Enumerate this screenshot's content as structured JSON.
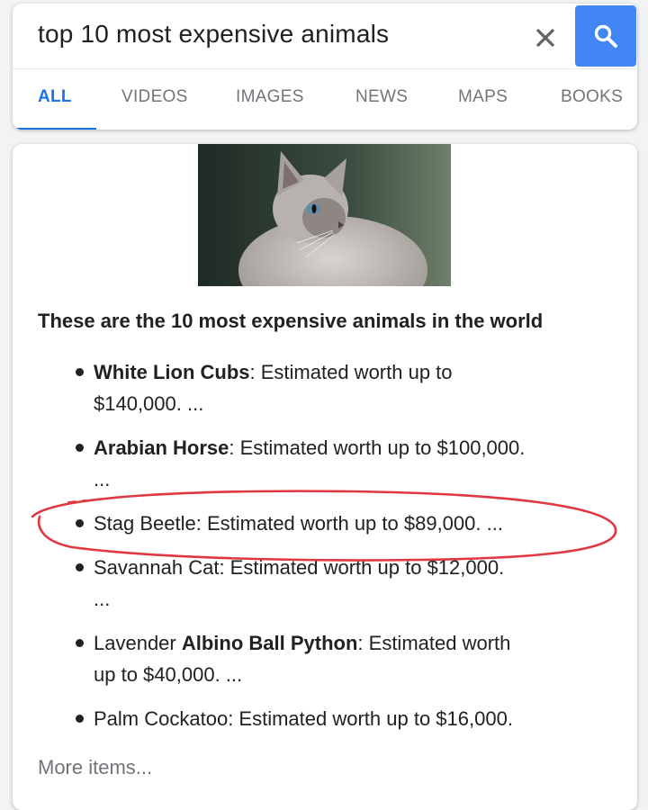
{
  "search": {
    "query": "top 10 most expensive animals"
  },
  "tabs": [
    {
      "label": "ALL",
      "active": true
    },
    {
      "label": "VIDEOS",
      "active": false
    },
    {
      "label": "IMAGES",
      "active": false
    },
    {
      "label": "NEWS",
      "active": false
    },
    {
      "label": "MAPS",
      "active": false
    },
    {
      "label": "BOOKS",
      "active": false
    }
  ],
  "result": {
    "heading": "These are the 10 most expensive animals in the world",
    "items": [
      {
        "bold": "White Lion Cubs",
        "pre": "",
        "rest": ": Estimated worth up to",
        "line2": "$140,000. ..."
      },
      {
        "bold": "Arabian Horse",
        "pre": "",
        "rest": ": Estimated worth up to $100,000.",
        "line2": "..."
      },
      {
        "bold": "",
        "pre": "Stag Beetle",
        "rest": ": Estimated worth up to $89,000. ...",
        "line2": ""
      },
      {
        "bold": "",
        "pre": "Savannah Cat",
        "rest": ": Estimated worth up to $12,000.",
        "line2": "..."
      },
      {
        "bold": "Albino Ball Python",
        "pre": "Lavender ",
        "rest": ": Estimated worth",
        "line2": "up to $40,000. ..."
      },
      {
        "bold": "",
        "pre": "Palm Cockatoo",
        "rest": ": Estimated worth up to $16,000.",
        "line2": ""
      }
    ],
    "more_label": "More items..."
  },
  "colors": {
    "accent": "#1a73e8",
    "search_button": "#4285f4",
    "annotation": "#e0383e"
  },
  "icons": {
    "clear": "close-icon",
    "search": "search-icon"
  }
}
